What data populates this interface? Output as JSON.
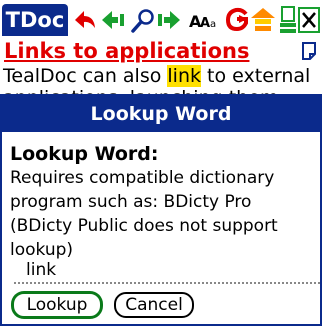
{
  "app": {
    "badge": "TDoc"
  },
  "toolbar": {
    "icons": [
      "back-arrow-icon",
      "prev-arrow-icon",
      "find-icon",
      "next-arrow-icon",
      "font-icon",
      "goto-icon",
      "home-icon",
      "scroll-icon",
      "close-icon"
    ],
    "colors": {
      "badge_bg": "#0b2a8c",
      "red": "#e00000",
      "green": "#19a030",
      "orange": "#ff8a00",
      "yellow": "#ffcc00"
    }
  },
  "document": {
    "title": "Links to applications",
    "line1_before": "TealDoc can also ",
    "line1_highlight": "link",
    "line1_after": " to external",
    "line2": "applications, launching them"
  },
  "dialog": {
    "title": "Lookup Word",
    "heading": "Lookup Word:",
    "description": "Requires compatible dictionary program such as:  BDicty Pro (BDicty Public does not support lookup)",
    "field_value": "link",
    "buttons": {
      "lookup": "Lookup",
      "cancel": "Cancel"
    }
  }
}
